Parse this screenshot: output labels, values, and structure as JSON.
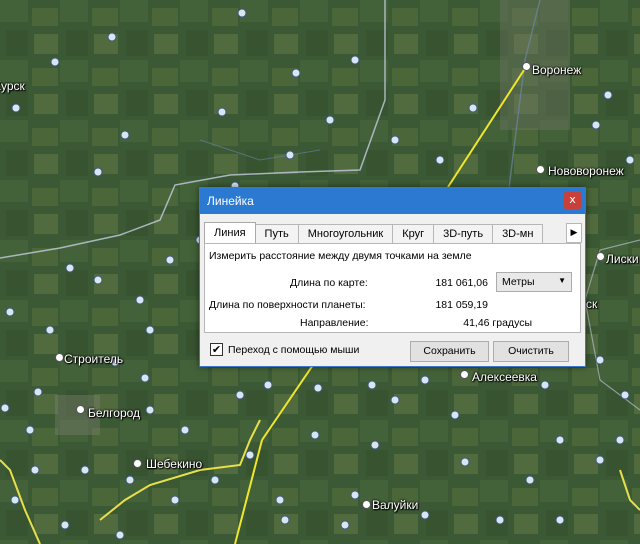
{
  "map": {
    "cities": [
      {
        "name": "Курск"
      },
      {
        "name": "Воронеж"
      },
      {
        "name": "Нововоронеж"
      },
      {
        "name": "Лиски"
      },
      {
        "name": "Строитель"
      },
      {
        "name": "Белгород"
      },
      {
        "name": "Шебекино"
      },
      {
        "name": "Алексеевка"
      },
      {
        "name": "Валуйки"
      },
      {
        "name": "ск"
      }
    ],
    "colors": {
      "ruler_line": "#f0e62a",
      "border": "#c6cde0",
      "region_border": "#e8e04a"
    }
  },
  "dialog": {
    "title": "Линейка",
    "close_glyph": "x",
    "tabs": [
      "Линия",
      "Путь",
      "Многоугольник",
      "Круг",
      "3D-путь",
      "3D-мн"
    ],
    "active_tab": "Линия",
    "description": "Измерить расстояние между двумя точками на земле",
    "map_length_label": "Длина по карте:",
    "map_length_value": "181 061,06",
    "units": "Метры",
    "surface_length_label": "Длина по поверхности планеты:",
    "surface_length_value": "181 059,19",
    "heading_label": "Направление:",
    "heading_value": "41,46 градусы",
    "mouse_nav_label": "Переход с помощью мыши",
    "mouse_nav_checked": "✔",
    "save_label": "Сохранить",
    "clear_label": "Очистить",
    "colors": {
      "title_bar": "#2b79d1",
      "close_button": "#c8403a"
    }
  }
}
